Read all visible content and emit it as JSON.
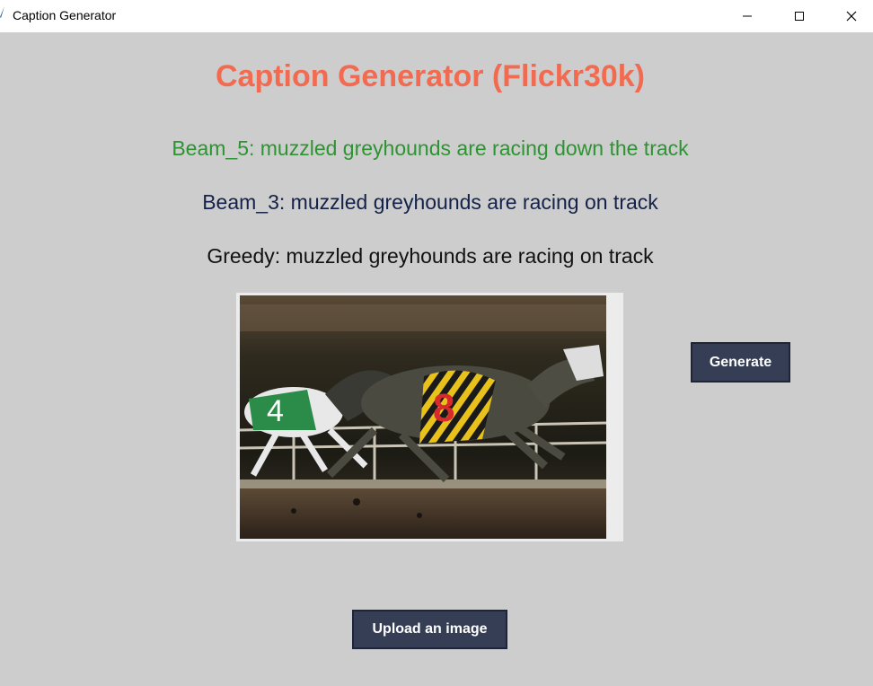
{
  "window": {
    "title": "Caption Generator",
    "minimize_glyph": "—",
    "maximize_glyph": "☐",
    "close_glyph": "✕"
  },
  "app": {
    "heading": "Caption Generator (Flickr30k)",
    "accent_color": "#f26b50"
  },
  "captions": {
    "beam5": "Beam_5: muzzled greyhounds are racing down the track",
    "beam3": "Beam_3: muzzled greyhounds are racing on track",
    "greedy": "Greedy: muzzled greyhounds are racing on track"
  },
  "image": {
    "dog_number_left": "4",
    "dog_number_right": "8"
  },
  "buttons": {
    "generate": "Generate",
    "upload": "Upload an image"
  }
}
